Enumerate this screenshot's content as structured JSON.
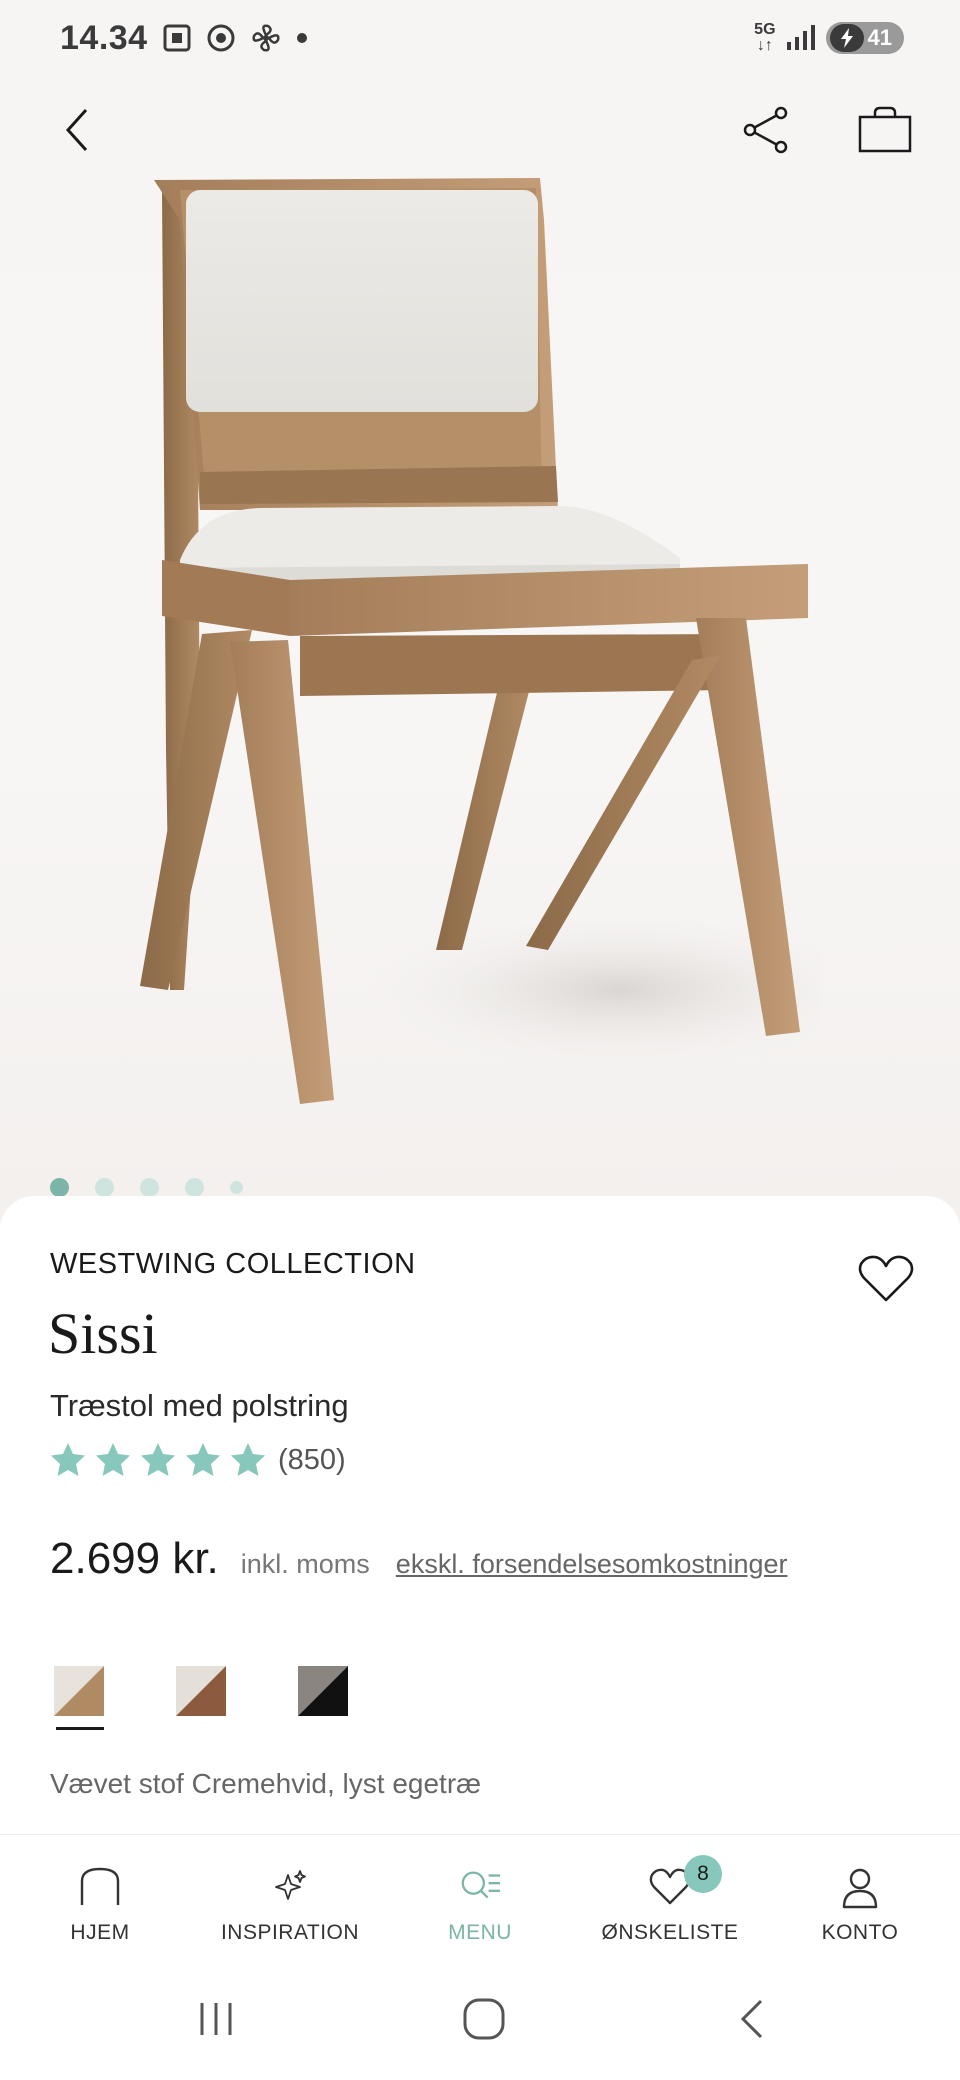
{
  "status_bar": {
    "time": "14.34",
    "network_top": "5G",
    "network_bottom": "↓↑",
    "battery": "41"
  },
  "product": {
    "brand": "WESTWING COLLECTION",
    "name": "Sissi",
    "subtitle": "Træstol med polstring",
    "rating": 5,
    "review_count": "(850)",
    "price": "2.699 kr.",
    "vat_note": "inkl. moms",
    "shipping_link": "ekskl. forsendelsesomkostninger",
    "selected_variant": "Vævet stof Cremehvid, lyst egetræ",
    "swatches": [
      {
        "name": "Cremehvid, lyst egetræ",
        "top": "#e7e3dc",
        "bottom": "#b08a63",
        "selected": true
      },
      {
        "name": "Cremehvid, mørkt træ",
        "top": "#e4e0d9",
        "bottom": "#8c5a3c",
        "selected": false
      },
      {
        "name": "Grå, sort",
        "top": "#8a8580",
        "bottom": "#111111",
        "selected": false
      }
    ],
    "image_count": 5,
    "active_image": 1
  },
  "colors": {
    "accent": "#7ab5a8",
    "star": "#88c7bb",
    "text": "#1a1a1a"
  },
  "bottom_nav": {
    "home": "HJEM",
    "inspiration": "INSPIRATION",
    "menu": "MENU",
    "wishlist": "ØNSKELISTE",
    "wishlist_count": "8",
    "account": "KONTO"
  }
}
